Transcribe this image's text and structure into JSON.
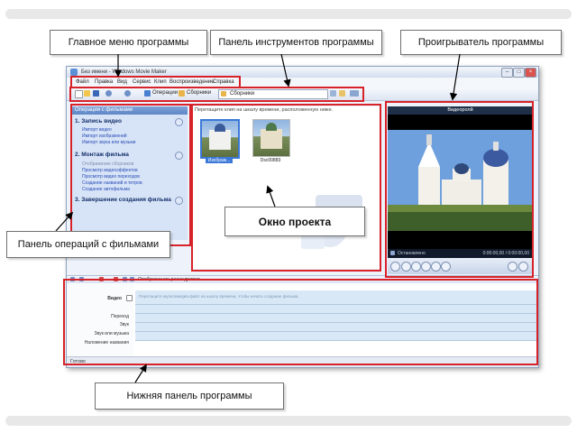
{
  "callouts": {
    "main_menu": "Главное меню программы",
    "toolbar": "Панель инструментов программы",
    "player": "Проигрыватель программы",
    "movie_tasks": "Панель операций с фильмами",
    "project_window": "Окно проекта",
    "bottom_panel": "Нижняя панель программы"
  },
  "window": {
    "title": "Без имени - Windows Movie Maker",
    "controls": [
      "–",
      "□",
      "×"
    ]
  },
  "menu": [
    "Файл",
    "Правка",
    "Вид",
    "Сервис",
    "Клип",
    "Воспроизведение",
    "Справка"
  ],
  "toolbar": {
    "operations": "Операции",
    "collections": "Сборники",
    "combo_value": "Сборники"
  },
  "tasks": {
    "header": "Операции с фильмами",
    "sections": [
      {
        "title": "1. Запись видео",
        "links": [
          "Импорт видео",
          "Импорт изображений",
          "Импорт звука или музыки"
        ]
      },
      {
        "title": "2. Монтаж фильма",
        "links": [
          "Отображение сборников",
          "Просмотр видеоэффектов",
          "Просмотр видео переходов",
          "Создание названий и титров",
          "Создание автофильма"
        ]
      },
      {
        "title": "3. Завершение создания фильма",
        "links": []
      }
    ]
  },
  "collection": {
    "hint": "Перетащите клип на шкалу времени, расположенную ниже.",
    "items": [
      "Изображ...",
      "Dsc00883"
    ]
  },
  "player": {
    "title": "Видеоролй",
    "status": "Остановлено",
    "time": "0:00:00,00 / 0:00:00,00"
  },
  "storyboard": {
    "toolbar_label": "Отображение раскадровки",
    "rows": [
      "Видео",
      "Переход",
      "Звук",
      "Звук или музыка",
      "Наложение названия"
    ],
    "hint": "Перетащите мультимедиа-файл на шкалу времени, чтобы начать создание фильма."
  },
  "statusbar": {
    "text": "Готово"
  },
  "colors": {
    "highlight": "#d8222a",
    "window_bg": "#eef3fb",
    "timeline": "#d9e8f6"
  }
}
